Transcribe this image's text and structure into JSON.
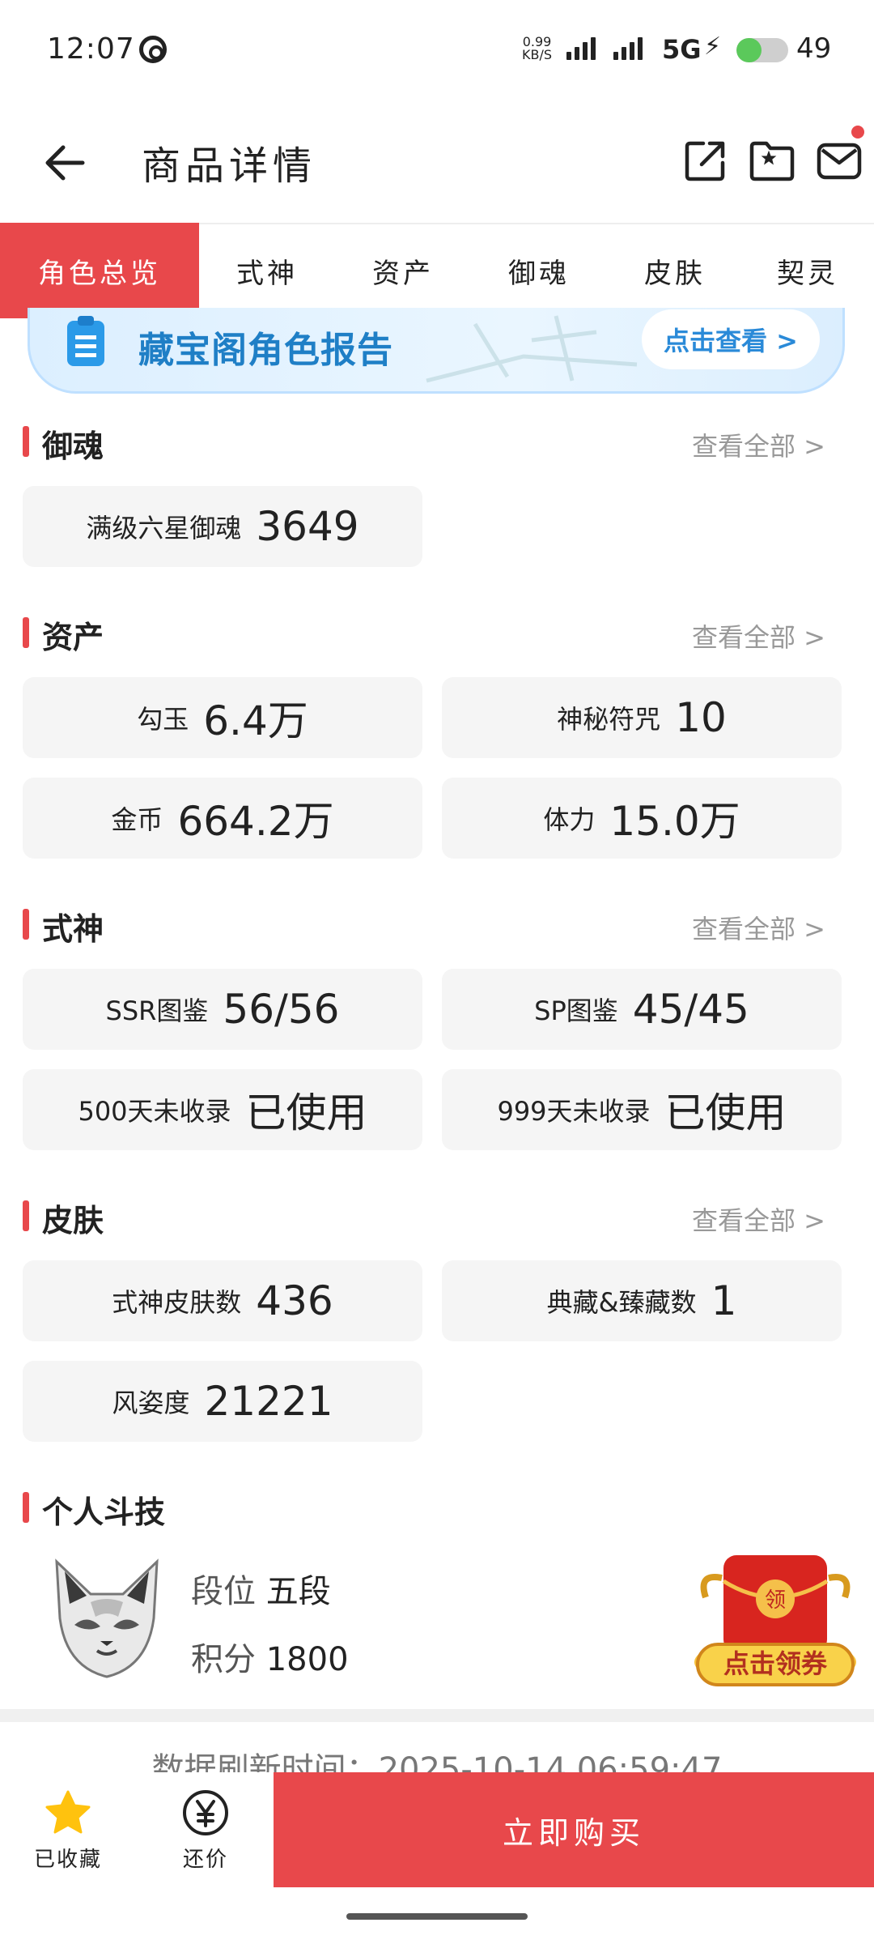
{
  "status_bar": {
    "time": "12:07",
    "speed_value": "0.99",
    "speed_unit": "KB/S",
    "network": "5G",
    "battery": "49",
    "battery_level": 0.49
  },
  "header": {
    "title": "商品详情"
  },
  "tabs": [
    {
      "label": "角色总览",
      "active": true
    },
    {
      "label": "式神"
    },
    {
      "label": "资产"
    },
    {
      "label": "御魂"
    },
    {
      "label": "皮肤"
    },
    {
      "label": "契灵"
    }
  ],
  "banner": {
    "text": "藏宝阁角色报告",
    "button": "点击查看 >"
  },
  "sections": {
    "yuhun": {
      "title": "御魂",
      "more": "查看全部 >",
      "items": [
        {
          "label": "满级六星御魂",
          "value": "3649"
        }
      ]
    },
    "assets": {
      "title": "资产",
      "more": "查看全部 >",
      "items": [
        {
          "label": "勾玉",
          "value": "6.4万"
        },
        {
          "label": "神秘符咒",
          "value": "10"
        },
        {
          "label": "金币",
          "value": "664.2万"
        },
        {
          "label": "体力",
          "value": "15.0万"
        }
      ]
    },
    "shikigami": {
      "title": "式神",
      "more": "查看全部 >",
      "items": [
        {
          "label": "SSR图鉴",
          "value": "56/56"
        },
        {
          "label": "SP图鉴",
          "value": "45/45"
        },
        {
          "label": "500天未收录",
          "value": "已使用"
        },
        {
          "label": "999天未收录",
          "value": "已使用"
        }
      ]
    },
    "skins": {
      "title": "皮肤",
      "more": "查看全部 >",
      "items": [
        {
          "label": "式神皮肤数",
          "value": "436"
        },
        {
          "label": "典藏&臻藏数",
          "value": "1"
        },
        {
          "label": "风姿度",
          "value": "21221"
        }
      ]
    },
    "pvp": {
      "title": "个人斗技",
      "rank_label": "段位",
      "rank_value": "五段",
      "score_label": "积分",
      "score_value": "1800",
      "coupon_badge": "领",
      "coupon_text": "点击领券"
    }
  },
  "refresh_text": "数据刷新时间：2025-10-14 06:59:47",
  "bottom_bar": {
    "favorite_label": "已收藏",
    "bargain_label": "还价",
    "buy_label": "立即购买"
  },
  "colors": {
    "accent": "#e8484b",
    "star": "#ffc20e",
    "banner_text": "#1f7fc6"
  }
}
